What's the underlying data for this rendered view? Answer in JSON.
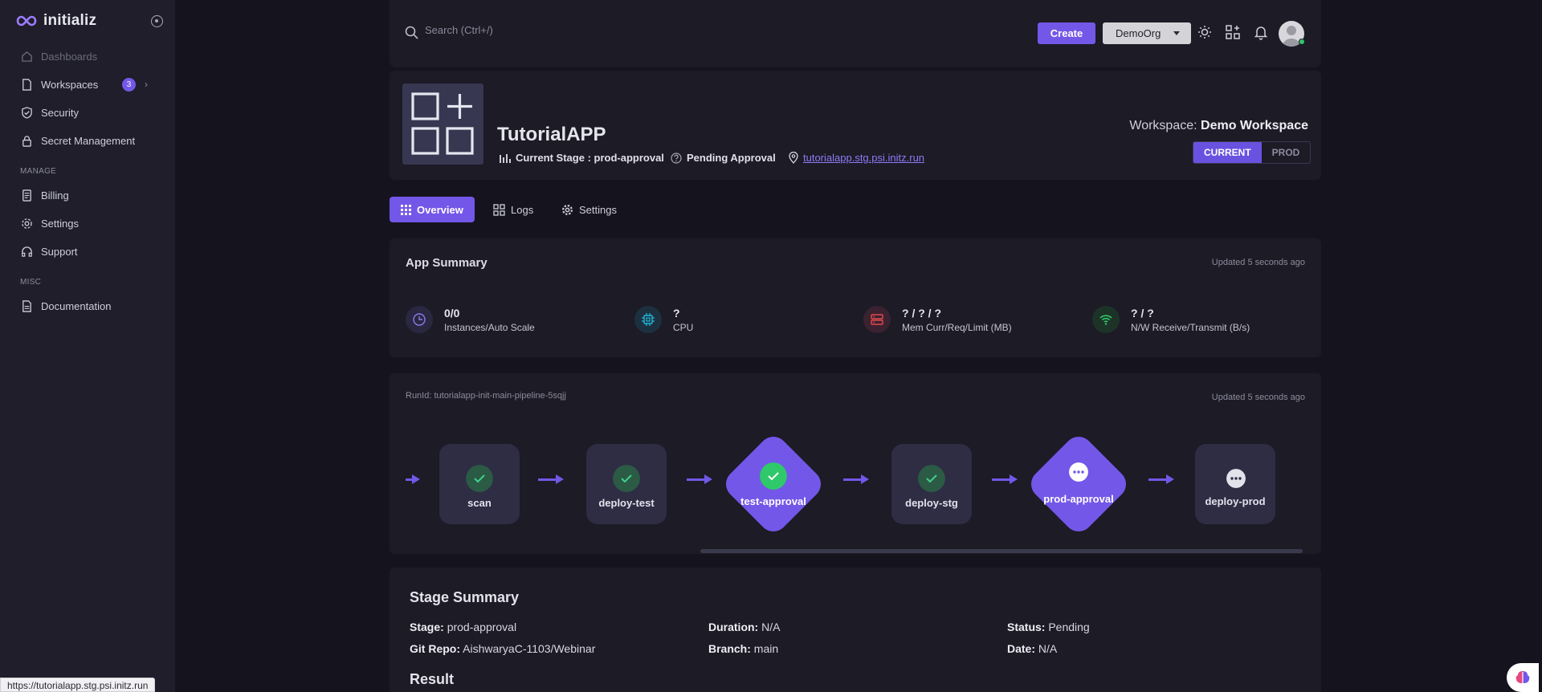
{
  "brand": {
    "name": "initializ"
  },
  "sidebar": {
    "items": [
      {
        "label": "Dashboards"
      },
      {
        "label": "Workspaces",
        "badge": "3"
      },
      {
        "label": "Security"
      },
      {
        "label": "Secret Management"
      }
    ],
    "manage_label": "MANAGE",
    "manage_items": [
      {
        "label": "Billing"
      },
      {
        "label": "Settings"
      },
      {
        "label": "Support"
      }
    ],
    "misc_label": "MISC",
    "misc_items": [
      {
        "label": "Documentation"
      }
    ]
  },
  "topbar": {
    "search_placeholder": "Search (Ctrl+/)",
    "create_label": "Create",
    "org_selected": "DemoOrg"
  },
  "app": {
    "name": "TutorialAPP",
    "current_stage": "Current Stage : prod-approval",
    "status": "Pending Approval",
    "url": "tutorialapp.stg.psi.initz.run",
    "workspace_prefix": "Workspace:",
    "workspace_name": "Demo Workspace",
    "env_current": "CURRENT",
    "env_prod": "PROD"
  },
  "tabs": [
    {
      "label": "Overview"
    },
    {
      "label": "Logs"
    },
    {
      "label": "Settings"
    }
  ],
  "summary": {
    "title": "App Summary",
    "updated": "Updated 5 seconds ago",
    "metrics": [
      {
        "value": "0/0",
        "label": "Instances/Auto Scale",
        "icon": "clock-icon",
        "color": "#8b79f0"
      },
      {
        "value": "?",
        "label": "CPU",
        "icon": "cpu-icon",
        "color": "#22b8d8"
      },
      {
        "value": "? / ? / ?",
        "label": "Mem Curr/Req/Limit (MB)",
        "icon": "server-icon",
        "color": "#e5484d"
      },
      {
        "value": "? / ?",
        "label": "N/W Receive/Transmit (B/s)",
        "icon": "wifi-icon",
        "color": "#2fc86a"
      }
    ]
  },
  "pipeline": {
    "run_id": "RunId: tutorialapp-init-main-pipeline-5sqjj",
    "updated": "Updated 5 seconds ago",
    "stages": [
      {
        "label": "scan",
        "state": "done"
      },
      {
        "label": "deploy-test",
        "state": "done"
      },
      {
        "label": "test-approval",
        "state": "approved"
      },
      {
        "label": "deploy-stg",
        "state": "done"
      },
      {
        "label": "prod-approval",
        "state": "pending-approval"
      },
      {
        "label": "deploy-prod",
        "state": "pending"
      }
    ]
  },
  "stage_summary": {
    "title": "Stage Summary",
    "stage_key": "Stage:",
    "stage_val": "prod-approval",
    "duration_key": "Duration:",
    "duration_val": "N/A",
    "status_key": "Status:",
    "status_val": "Pending",
    "repo_key": "Git Repo:",
    "repo_val": "AishwaryaC-1103/Webinar",
    "branch_key": "Branch:",
    "branch_val": "main",
    "date_key": "Date:",
    "date_val": "N/A",
    "result_title": "Result"
  },
  "status_bar": {
    "url": "https://tutorialapp.stg.psi.initz.run"
  },
  "colors": {
    "accent": "#7357e8",
    "success": "#2fc86a",
    "background": "#15141e",
    "card": "#1c1b26"
  }
}
